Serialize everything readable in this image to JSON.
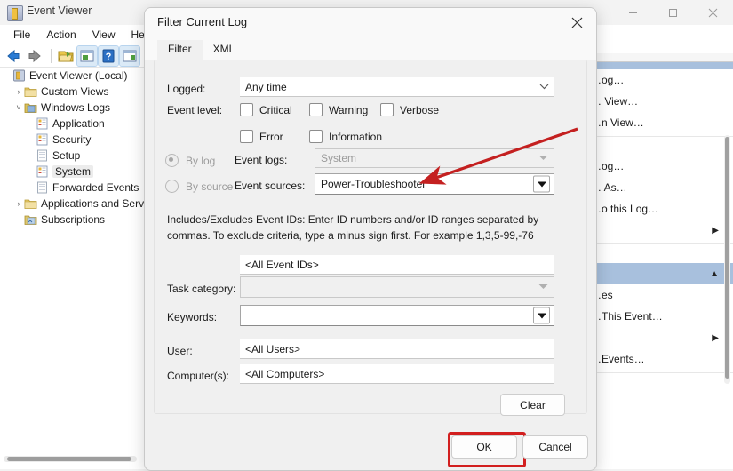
{
  "window": {
    "title": "Event Viewer",
    "icon": "event-viewer-icon",
    "controls": {
      "minimize": "—",
      "maximize": "☐",
      "close": "✕"
    }
  },
  "menu": {
    "items": [
      "File",
      "Action",
      "View",
      "Help"
    ]
  },
  "toolbar": {
    "items": [
      {
        "name": "back-icon",
        "label": "Back"
      },
      {
        "name": "forward-icon",
        "label": "Forward"
      },
      {
        "name": "open-folder-icon",
        "label": "Open Saved Log"
      },
      {
        "name": "properties-icon",
        "label": "Properties"
      },
      {
        "name": "help-icon",
        "label": "Help"
      },
      {
        "name": "show-action-pane-icon",
        "label": "Show/Hide Action Pane"
      }
    ]
  },
  "tree": {
    "items": [
      {
        "label": "Event Viewer (Local)",
        "indent": 0,
        "chevron": "",
        "icon": "event-viewer-icon",
        "selected": false
      },
      {
        "label": "Custom Views",
        "indent": 1,
        "chevron": "›",
        "icon": "folder-icon",
        "selected": false
      },
      {
        "label": "Windows Logs",
        "indent": 1,
        "chevron": "˅",
        "icon": "logs-folder-icon",
        "selected": false
      },
      {
        "label": "Application",
        "indent": 2,
        "chevron": "",
        "icon": "log-icon",
        "selected": false
      },
      {
        "label": "Security",
        "indent": 2,
        "chevron": "",
        "icon": "log-icon",
        "selected": false
      },
      {
        "label": "Setup",
        "indent": 2,
        "chevron": "",
        "icon": "plain-log-icon",
        "selected": false
      },
      {
        "label": "System",
        "indent": 2,
        "chevron": "",
        "icon": "log-icon",
        "selected": true
      },
      {
        "label": "Forwarded Events",
        "indent": 2,
        "chevron": "",
        "icon": "plain-log-icon",
        "selected": false
      },
      {
        "label": "Applications and Services",
        "indent": 1,
        "chevron": "›",
        "icon": "folder-icon",
        "selected": false
      },
      {
        "label": "Subscriptions",
        "indent": 1,
        "chevron": "",
        "icon": "subscriptions-icon",
        "selected": false
      }
    ]
  },
  "actions_pane": {
    "rows": [
      {
        "label": "…og…",
        "arrow": false,
        "selected": false,
        "sep_after": false
      },
      {
        "label": "… View…",
        "arrow": false,
        "selected": false,
        "sep_after": false
      },
      {
        "label": "…n View…",
        "arrow": false,
        "selected": false,
        "sep_after": true
      },
      {
        "label": "…og…",
        "arrow": false,
        "selected": false,
        "sep_after": false
      },
      {
        "label": "… As…",
        "arrow": false,
        "selected": false,
        "sep_after": false
      },
      {
        "label": "…o this Log…",
        "arrow": false,
        "selected": false,
        "sep_after": false
      },
      {
        "label": "",
        "arrow": true,
        "selected": false,
        "sep_after": true
      },
      {
        "label": "",
        "arrow": false,
        "selected": true,
        "sep_after": false
      },
      {
        "label": "…es",
        "arrow": false,
        "selected": false,
        "sep_after": false
      },
      {
        "label": "…This Event…",
        "arrow": false,
        "selected": false,
        "sep_after": false
      },
      {
        "label": "",
        "arrow": true,
        "selected": false,
        "sep_after": false
      },
      {
        "label": "…Events…",
        "arrow": false,
        "selected": false,
        "sep_after": true
      }
    ]
  },
  "dialog": {
    "title": "Filter Current Log",
    "close_icon": "close-icon",
    "tabs": [
      {
        "label": "Filter",
        "active": true
      },
      {
        "label": "XML",
        "active": false
      }
    ],
    "fields": {
      "logged_label": "Logged:",
      "logged_value": "Any time",
      "event_level_label": "Event level:",
      "levels": [
        {
          "label": "Critical",
          "checked": false
        },
        {
          "label": "Warning",
          "checked": false
        },
        {
          "label": "Verbose",
          "checked": false
        },
        {
          "label": "Error",
          "checked": false
        },
        {
          "label": "Information",
          "checked": false
        }
      ],
      "by_log_label": "By log",
      "by_log_selected": true,
      "by_source_label": "By source",
      "by_source_selected": false,
      "event_logs_label": "Event logs:",
      "event_logs_value": "System",
      "event_sources_label": "Event sources:",
      "event_sources_value": "Power-Troubleshooter",
      "hint": "Includes/Excludes Event IDs: Enter ID numbers and/or ID ranges separated by commas. To exclude criteria, type a minus sign first. For example 1,3,5-99,-76",
      "event_ids_value": "<All Event IDs>",
      "task_category_label": "Task category:",
      "task_category_value": "",
      "keywords_label": "Keywords:",
      "keywords_value": "",
      "user_label": "User:",
      "user_value": "<All Users>",
      "computers_label": "Computer(s):",
      "computers_value": "<All Computers>"
    },
    "buttons": {
      "clear": "Clear",
      "ok": "OK",
      "cancel": "Cancel"
    }
  },
  "annotations": {
    "highlight_color": "#d21f1f",
    "arrow_color": "#c42020",
    "arrow_target": "event-sources-combobox",
    "highlight_target": "ok-button"
  }
}
